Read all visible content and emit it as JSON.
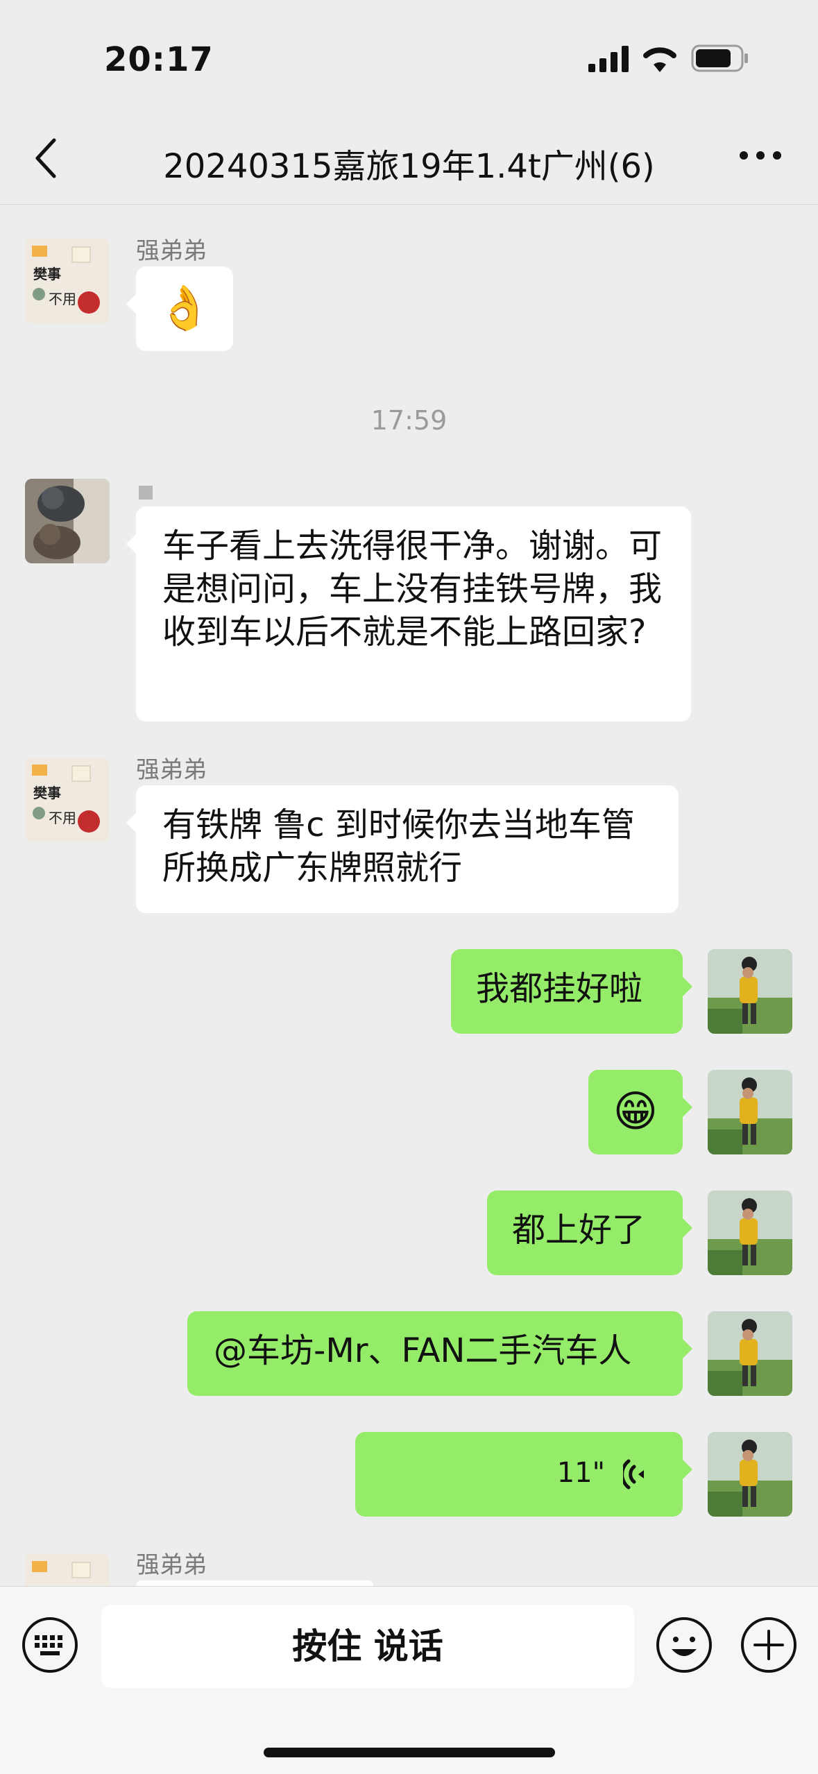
{
  "status": {
    "time": "20:17"
  },
  "header": {
    "title": "20240315嘉旅19年1.4t广州(6)"
  },
  "messages": {
    "m1": {
      "sender": "强弟弟",
      "content": "👌"
    },
    "timestamp": "17:59",
    "m2": {
      "text": "车子看上去洗得很干净。谢谢。可是想问问，车上没有挂铁号牌，我收到车以后不就是不能上路回家?"
    },
    "m3": {
      "sender": "强弟弟",
      "text": "有铁牌  鲁c  到时候你去当地车管所换成广东牌照就行"
    },
    "m4": {
      "text": "我都挂好啦"
    },
    "m5": {
      "content": "😁"
    },
    "m6": {
      "text": "都上好了"
    },
    "m7": {
      "text": "@车坊-Mr、FAN二手汽车人"
    },
    "m8": {
      "duration": "11\""
    },
    "m9": {
      "sender": "强弟弟"
    }
  },
  "input": {
    "talk_label": "按住 说话"
  },
  "colors": {
    "self_bubble": "#95ec69",
    "other_bubble": "#ffffff",
    "background": "#ededed"
  },
  "icons": {
    "back": "chevron-left-icon",
    "more": "more-icon",
    "keyboard": "keyboard-icon",
    "emoji": "emoji-icon",
    "plus": "plus-icon",
    "voice": "voice-wave-icon"
  }
}
